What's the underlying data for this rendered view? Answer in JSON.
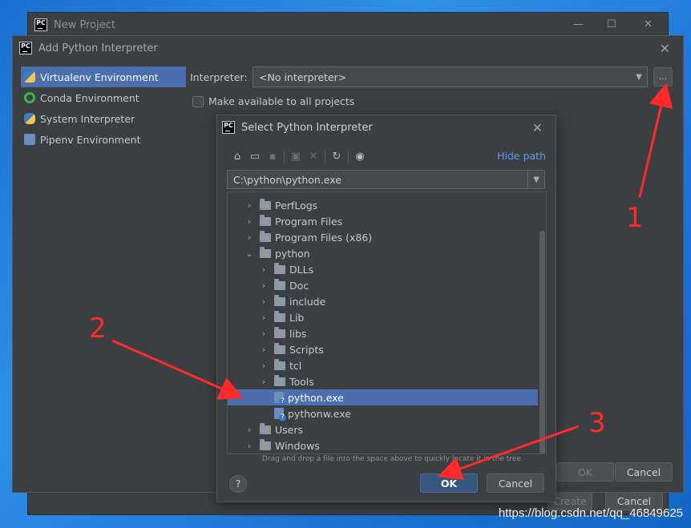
{
  "new_project": {
    "title": "New Project",
    "minimize": "—",
    "maximize": "☐",
    "close": "✕",
    "create_label": "Create",
    "cancel_label": "Cancel"
  },
  "add_interpreter": {
    "title": "Add Python Interpreter",
    "close": "✕",
    "sidebar": [
      {
        "label": "Virtualenv Environment",
        "icon": "virtualenv-icon",
        "selected": true
      },
      {
        "label": "Conda Environment",
        "icon": "conda-icon",
        "selected": false
      },
      {
        "label": "System Interpreter",
        "icon": "python-icon",
        "selected": false
      },
      {
        "label": "Pipenv Environment",
        "icon": "pipenv-icon",
        "selected": false
      }
    ],
    "interpreter_label": "Interpreter:",
    "interpreter_value": "<No interpreter>",
    "browse_label": "...",
    "make_available_label": "Make available to all projects",
    "ok_label": "OK",
    "cancel_label": "Cancel"
  },
  "select_interpreter": {
    "title": "Select Python Interpreter",
    "close": "✕",
    "toolbar": [
      "home-icon",
      "desktop-icon",
      "project-icon",
      "new-folder-icon",
      "delete-icon",
      "refresh-icon",
      "show-hidden-icon"
    ],
    "hide_path_label": "Hide path",
    "path_value": "C:\\python\\python.exe",
    "tree": [
      {
        "label": "PerfLogs",
        "type": "folder",
        "level": 0,
        "expanded": false
      },
      {
        "label": "Program Files",
        "type": "folder",
        "level": 0,
        "expanded": false
      },
      {
        "label": "Program Files (x86)",
        "type": "folder",
        "level": 0,
        "expanded": false
      },
      {
        "label": "python",
        "type": "folder",
        "level": 0,
        "expanded": true
      },
      {
        "label": "DLLs",
        "type": "folder",
        "level": 1,
        "expanded": false
      },
      {
        "label": "Doc",
        "type": "folder",
        "level": 1,
        "expanded": false
      },
      {
        "label": "include",
        "type": "folder",
        "level": 1,
        "expanded": false
      },
      {
        "label": "Lib",
        "type": "folder",
        "level": 1,
        "expanded": false
      },
      {
        "label": "libs",
        "type": "folder",
        "level": 1,
        "expanded": false
      },
      {
        "label": "Scripts",
        "type": "folder",
        "level": 1,
        "expanded": false
      },
      {
        "label": "tcl",
        "type": "folder",
        "level": 1,
        "expanded": false
      },
      {
        "label": "Tools",
        "type": "folder",
        "level": 1,
        "expanded": false
      },
      {
        "label": "python.exe",
        "type": "file",
        "level": 1,
        "selected": true
      },
      {
        "label": "pythonw.exe",
        "type": "file",
        "level": 1
      },
      {
        "label": "Users",
        "type": "folder",
        "level": 0,
        "expanded": false
      },
      {
        "label": "Windows",
        "type": "folder",
        "level": 0,
        "expanded": false
      }
    ],
    "hint": "Drag and drop a file into the space above to quickly locate it in the tree",
    "help_label": "?",
    "ok_label": "OK",
    "cancel_label": "Cancel"
  },
  "annotations": {
    "one": "1",
    "two": "2",
    "three": "3"
  },
  "watermark": "https://blog.csdn.net/qq_46849625",
  "colors": {
    "selection": "#4b6eaf",
    "annotation": "#ff2a2a",
    "link": "#589df6"
  }
}
